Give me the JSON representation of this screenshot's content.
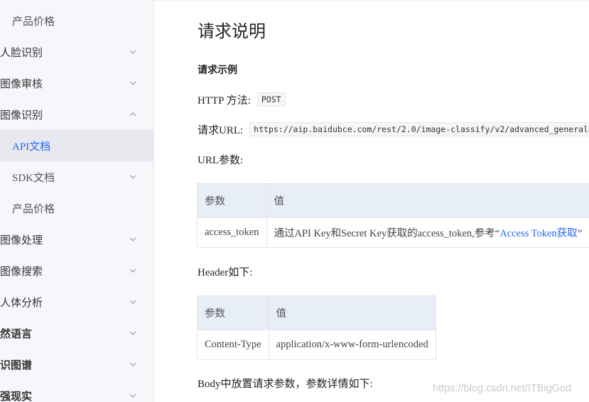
{
  "sidebar": {
    "items": [
      {
        "label": "产品价格",
        "chevron": "none"
      },
      {
        "label": "人脸识别",
        "chevron": "down"
      },
      {
        "label": "图像审核",
        "chevron": "down"
      },
      {
        "label": "图像识别",
        "chevron": "up"
      },
      {
        "label": "API文档",
        "chevron": "none",
        "active": true
      },
      {
        "label": "SDK文档",
        "chevron": "down"
      },
      {
        "label": "产品价格",
        "chevron": "none"
      },
      {
        "label": "图像处理",
        "chevron": "down"
      },
      {
        "label": "图像搜索",
        "chevron": "down"
      },
      {
        "label": "人体分析",
        "chevron": "down"
      },
      {
        "label": "然语言",
        "chevron": "down"
      },
      {
        "label": "识图谱",
        "chevron": "down"
      },
      {
        "label": "强现实",
        "chevron": "down"
      }
    ]
  },
  "main": {
    "title": "请求说明",
    "section_title": "请求示例",
    "http_method_label": "HTTP 方法:",
    "http_method_value": "POST",
    "url_label": "请求URL:",
    "url_value": "https://aip.baidubce.com/rest/2.0/image-classify/v2/advanced_general",
    "url_params_label": "URL参数:",
    "url_params_table": {
      "headers": [
        "参数",
        "值"
      ],
      "rows": [
        {
          "param": "access_token",
          "value_prefix": "通过API Key和Secret Key获取的access_token,参考“",
          "link_text": "Access Token获取",
          "value_suffix": "”"
        }
      ]
    },
    "header_label": "Header如下:",
    "header_table": {
      "headers": [
        "参数",
        "值"
      ],
      "rows": [
        {
          "param": "Content-Type",
          "value": "application/x-www-form-urlencoded"
        }
      ]
    },
    "body_label": "Body中放置请求参数，参数详情如下:"
  },
  "watermark": "https://blog.csdn.net/ITBigGod",
  "colors": {
    "accent": "#2468f2",
    "sidebar_bg": "#f6f7fb",
    "active_bg": "#e7e9ee",
    "table_header_bg": "#e8eef7"
  }
}
